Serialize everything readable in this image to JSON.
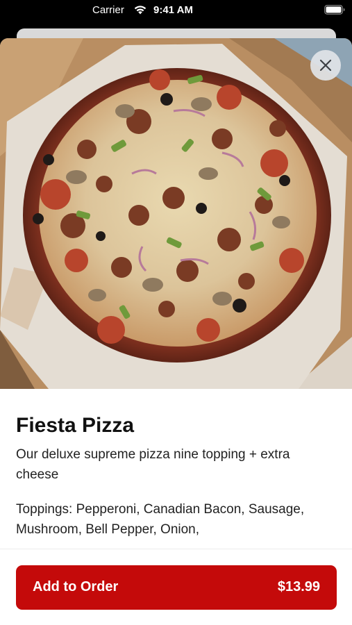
{
  "status_bar": {
    "carrier": "Carrier",
    "time": "9:41 AM"
  },
  "product": {
    "title": "Fiesta Pizza",
    "description": "Our deluxe supreme pizza nine topping + extra cheese",
    "toppings": "Toppings: Pepperoni, Canadian Bacon, Sausage, Mushroom, Bell Pepper, Onion,"
  },
  "actions": {
    "add_label": "Add to Order",
    "price": "$13.99"
  },
  "icons": {
    "close": "close-icon",
    "wifi": "wifi-icon",
    "battery": "battery-icon"
  },
  "colors": {
    "accent": "#c40a0a",
    "status_bar_bg": "#000000"
  }
}
